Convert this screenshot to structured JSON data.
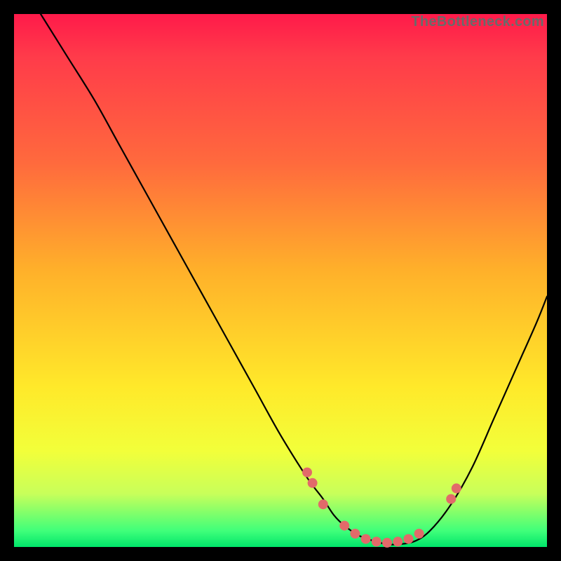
{
  "attribution": "TheBottleneck.com",
  "colors": {
    "marker_fill": "#e26a6a",
    "curve_stroke": "#000000",
    "page_bg": "#000000"
  },
  "chart_data": {
    "type": "line",
    "title": "",
    "xlabel": "",
    "ylabel": "",
    "xlim": [
      0,
      100
    ],
    "ylim": [
      0,
      100
    ],
    "grid": false,
    "legend": false,
    "series": [
      {
        "name": "curve",
        "x": [
          5,
          10,
          15,
          20,
          25,
          30,
          35,
          40,
          45,
          50,
          55,
          58,
          60,
          62,
          65,
          68,
          70,
          72,
          75,
          78,
          82,
          86,
          90,
          94,
          98,
          100
        ],
        "y": [
          100,
          92,
          84,
          75,
          66,
          57,
          48,
          39,
          30,
          21,
          13,
          9,
          6,
          4,
          2,
          1,
          0.5,
          0.5,
          1,
          3,
          8,
          15,
          24,
          33,
          42,
          47
        ]
      }
    ],
    "markers": {
      "name": "dots",
      "x": [
        55,
        56,
        58,
        62,
        64,
        66,
        68,
        70,
        72,
        74,
        76,
        82,
        83
      ],
      "y": [
        14,
        12,
        8,
        4,
        2.5,
        1.5,
        1,
        0.8,
        1,
        1.5,
        2.5,
        9,
        11
      ]
    }
  }
}
